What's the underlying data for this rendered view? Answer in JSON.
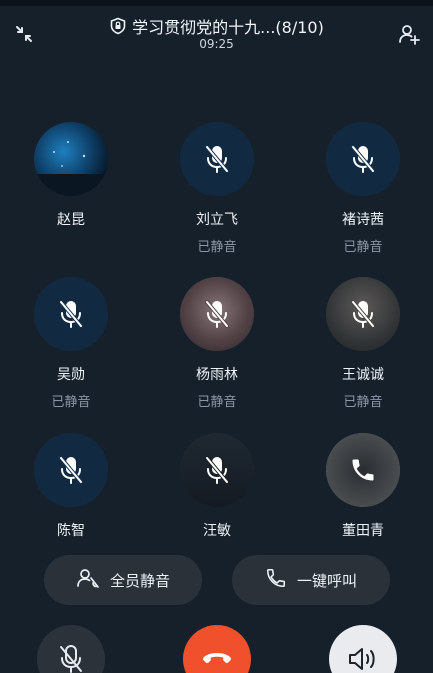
{
  "header": {
    "title": "学习贯彻党的十九...(8/10)",
    "time": "09:25"
  },
  "members": [
    {
      "name": "赵昆",
      "status": ""
    },
    {
      "name": "刘立飞",
      "status": "已静音"
    },
    {
      "name": "褚诗茜",
      "status": "已静音"
    },
    {
      "name": "吴勋",
      "status": "已静音"
    },
    {
      "name": "杨雨林",
      "status": "已静音"
    },
    {
      "name": "王诚诚",
      "status": "已静音"
    },
    {
      "name": "陈智",
      "status": ""
    },
    {
      "name": "汪敏",
      "status": ""
    },
    {
      "name": "董田青",
      "status": ""
    }
  ],
  "actions": {
    "mute_all": "全员静音",
    "call_all": "一键呼叫"
  },
  "colors": {
    "background": "#16202b",
    "hangup": "#f1502d",
    "muted_avatar": "#173550",
    "pill": "#2a3139"
  }
}
